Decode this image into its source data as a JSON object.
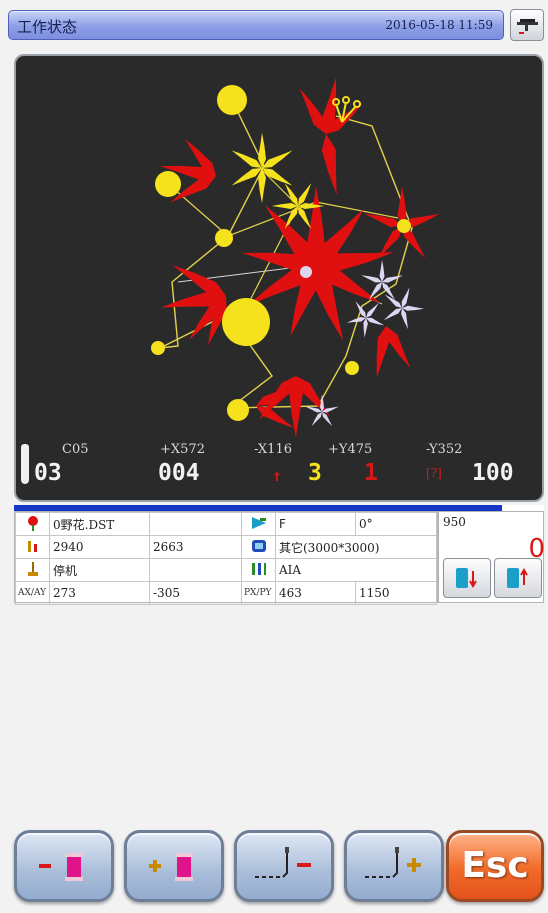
{
  "header": {
    "title": "工作状态",
    "datetime": "2016-05-18  11:59"
  },
  "canvas": {
    "readouts": {
      "needle_code": "C05",
      "x_plus": "+X572",
      "x_minus": "-X116",
      "y_plus": "+Y475",
      "y_minus": "-Y352",
      "needle_no": "03",
      "stitch_no": "004",
      "count_a": "3",
      "count_b": "1",
      "speed": "100",
      "speed_badge": "[?]"
    },
    "progress_percent": 92
  },
  "info": {
    "rows": [
      {
        "icon": "flower-icon",
        "c1": "0野花.DST",
        "c2": "",
        "icon2": "frame-icon",
        "c3": "F",
        "c4": "0°"
      },
      {
        "icon": "stitch-icon",
        "c1": "2940",
        "c2": "2663",
        "icon2": "hoop-icon",
        "c3": "其它(3000*3000)",
        "c4": ""
      },
      {
        "icon": "machine-icon",
        "c1": "停机",
        "c2": "",
        "icon2": "needle-bar-icon",
        "c3": "AIA",
        "c4": ""
      },
      {
        "label": "AX/AY",
        "c1": "273",
        "c2": "-305",
        "label2": "PX/PY",
        "c3": "463",
        "c4": "1150"
      }
    ],
    "right_value": "950",
    "right_red": "0"
  },
  "buttons": {
    "esc": "Esc"
  },
  "colors": {
    "accent_red": "#d81818",
    "thread_yellow": "#f5e11c",
    "thread_red": "#e01010"
  }
}
